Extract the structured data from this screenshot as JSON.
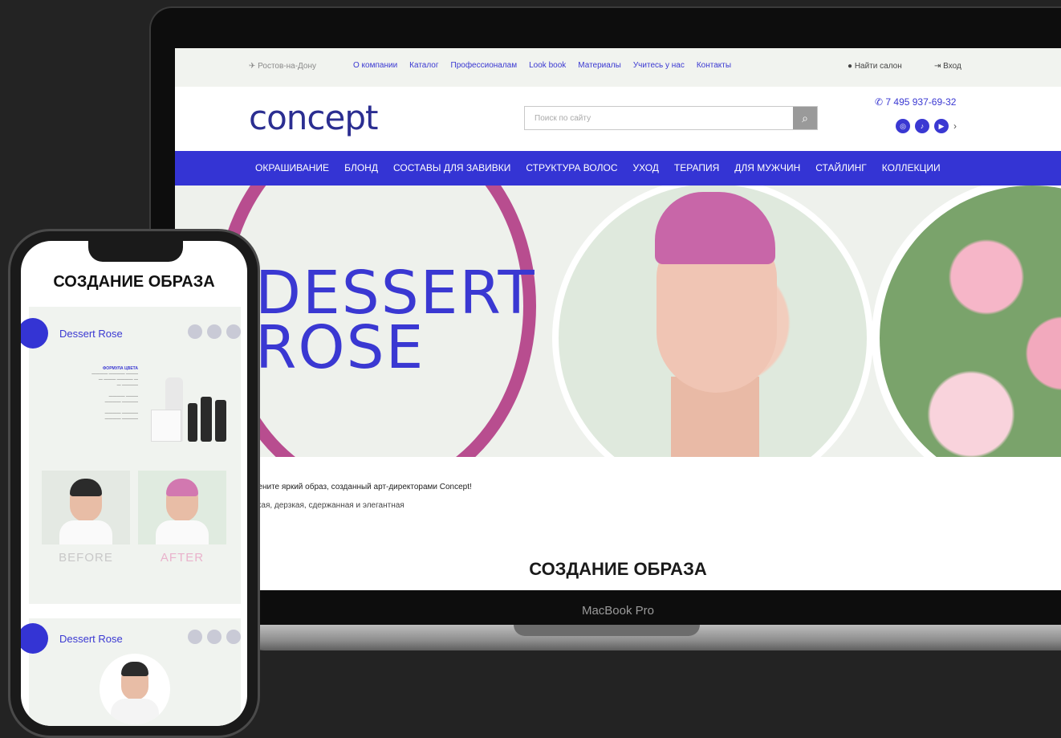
{
  "laptop": {
    "brand": "MacBook Pro",
    "topbar": {
      "city": "✈ Ростов-на-Дону",
      "nav": [
        "О компании",
        "Каталог",
        "Профессионалам",
        "Look book",
        "Материалы",
        "Учитесь у нас",
        "Контакты"
      ],
      "salon": "Найти салон",
      "login": "Вход"
    },
    "header": {
      "logo": "concept",
      "search_placeholder": "Поиск по сайту",
      "phone": "7 495 937-69-32"
    },
    "categories": [
      "ОКРАШИВАНИЕ",
      "БЛОНД",
      "СОСТАВЫ ДЛЯ ЗАВИВКИ",
      "СТРУКТУРА ВОЛОС",
      "УХОД",
      "ТЕРАПИЯ",
      "ДЛЯ МУЖЧИН",
      "СТАЙЛИНГ",
      "КОЛЛЕКЦИИ"
    ],
    "hero": {
      "title_line1": "DESSERT",
      "title_line2": "ROSE"
    },
    "desc1": "Оцените яркий образ, созданный арт-директорами Concept!",
    "desc2": "Яркая, дерзкая, сдержанная и элегантная",
    "section_title": "СОЗДАНИЕ ОБРАЗА"
  },
  "phone": {
    "title": "СОЗДАНИЕ ОБРАЗА",
    "card1_title": "Dessert Rose",
    "formula_heading": "ФОРМУЛА ЦВЕТА",
    "before": "BEFORE",
    "after": "AFTER",
    "card2_title": "Dessert Rose"
  },
  "colors": {
    "accent": "#3434d4",
    "pink": "#b84d8f",
    "background": "#232323"
  }
}
